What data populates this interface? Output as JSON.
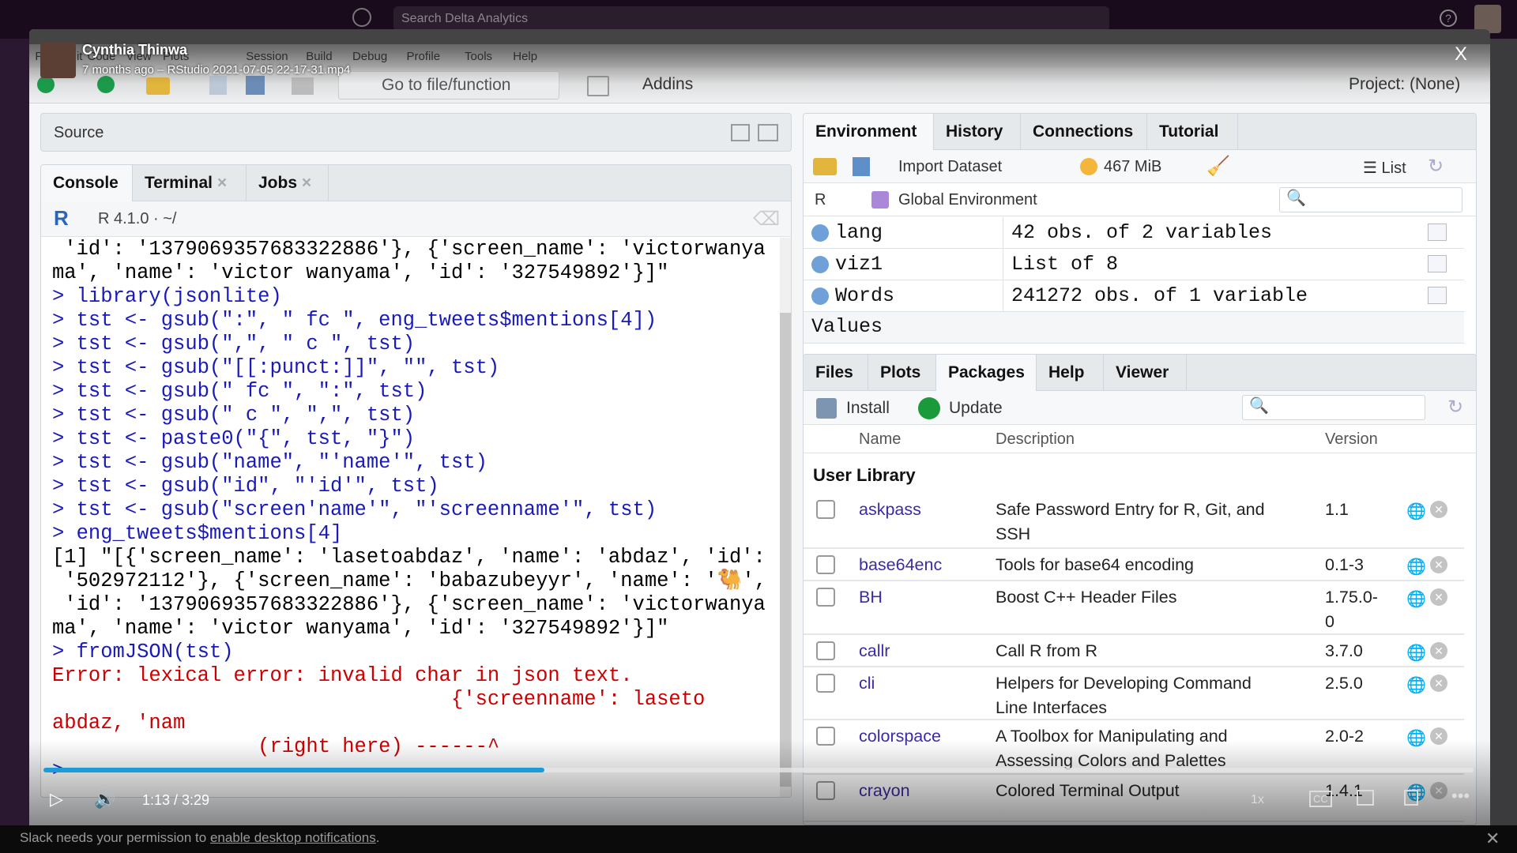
{
  "slack": {
    "search_placeholder": "Search Delta Analytics",
    "notification_text": "Slack needs your permission to ",
    "notification_link": "enable desktop notifications",
    "notification_end": "."
  },
  "video": {
    "author": "Cynthia Thinwa",
    "subtitle": "7 months ago – RStudio 2021-07-05 22-17-31.mp4",
    "time": "1:13 / 3:29",
    "progress": 0.35,
    "speed": "1x",
    "close": "X"
  },
  "menu": [
    "File",
    "Edit",
    "Code",
    "View",
    "Plots",
    "Session",
    "Build",
    "Debug",
    "Profile",
    "Tools",
    "Help"
  ],
  "toolbar": {
    "goto_placeholder": "Go to file/function",
    "addins": "Addins",
    "project": "Project: (None)"
  },
  "source": {
    "title": "Source"
  },
  "console": {
    "tabs": [
      "Console",
      "Terminal",
      "Jobs"
    ],
    "r_version": "R 4.1.0 · ~/",
    "lines": [
      {
        "t": " 'id': '1379069357683322886'}, {'screen_name': 'victorwanya",
        "c": ""
      },
      {
        "t": "ma', 'name': 'victor wanyama', 'id': '327549892'}]\"",
        "c": ""
      },
      {
        "t": "> library(jsonlite)",
        "c": "blue"
      },
      {
        "t": "> tst <- gsub(\":\", \" fc \", eng_tweets$mentions[4])",
        "c": "blue"
      },
      {
        "t": "> tst <- gsub(\",\", \" c \", tst)",
        "c": "blue"
      },
      {
        "t": "> tst <- gsub(\"[[:punct:]]\", \"\", tst)",
        "c": "blue"
      },
      {
        "t": "> tst <- gsub(\" fc \", \":\", tst)",
        "c": "blue"
      },
      {
        "t": "> tst <- gsub(\" c \", \",\", tst)",
        "c": "blue"
      },
      {
        "t": "> tst <- paste0(\"{\", tst, \"}\")",
        "c": "blue"
      },
      {
        "t": "> tst <- gsub(\"name\", \"'name'\", tst)",
        "c": "blue"
      },
      {
        "t": "> tst <- gsub(\"id\", \"'id'\", tst)",
        "c": "blue"
      },
      {
        "t": "> tst <- gsub(\"screen'name'\", \"'screenname'\", tst)",
        "c": "blue"
      },
      {
        "t": "> eng_tweets$mentions[4]",
        "c": "blue"
      },
      {
        "t": "[1] \"[{'screen_name': 'lasetoabdaz', 'name': 'abdaz', 'id':",
        "c": ""
      },
      {
        "t": " '502972112'}, {'screen_name': 'babazubeyyr', 'name': '🐫',",
        "c": ""
      },
      {
        "t": " 'id': '1379069357683322886'}, {'screen_name': 'victorwanya",
        "c": ""
      },
      {
        "t": "ma', 'name': 'victor wanyama', 'id': '327549892'}]\"",
        "c": ""
      },
      {
        "t": "> fromJSON(tst)",
        "c": "blue"
      },
      {
        "t": "Error: lexical error: invalid char in json text.",
        "c": "red"
      },
      {
        "t": "                                 {'screenname': laseto",
        "c": "red"
      },
      {
        "t": "abdaz, 'nam",
        "c": "red"
      },
      {
        "t": "                 (right here) ------^",
        "c": "red"
      },
      {
        "t": ">",
        "c": "blue"
      }
    ]
  },
  "environment": {
    "tabs": [
      "Environment",
      "History",
      "Connections",
      "Tutorial"
    ],
    "import_dataset": "Import Dataset",
    "memory": "467 MiB",
    "view_mode": "List",
    "language": "R",
    "scope": "Global Environment",
    "rows": [
      {
        "name": "lang",
        "value": "42 obs. of 2 variables",
        "icon": "table-icon"
      },
      {
        "name": "viz1",
        "value": "List of  8",
        "icon": "search-icon"
      },
      {
        "name": "Words",
        "value": "241272 obs. of 1 variable",
        "icon": "table-icon"
      }
    ],
    "section": "Values"
  },
  "packages": {
    "tabs": [
      "Files",
      "Plots",
      "Packages",
      "Help",
      "Viewer"
    ],
    "install": "Install",
    "update": "Update",
    "columns": [
      "Name",
      "Description",
      "Version"
    ],
    "library": "User Library",
    "rows": [
      {
        "name": "askpass",
        "desc": "Safe Password Entry for R, Git, and SSH",
        "version": "1.1"
      },
      {
        "name": "base64enc",
        "desc": "Tools for base64 encoding",
        "version": "0.1-3"
      },
      {
        "name": "BH",
        "desc": "Boost C++ Header Files",
        "version": "1.75.0-0"
      },
      {
        "name": "callr",
        "desc": "Call R from R",
        "version": "3.7.0"
      },
      {
        "name": "cli",
        "desc": "Helpers for Developing Command Line Interfaces",
        "version": "2.5.0"
      },
      {
        "name": "colorspace",
        "desc": "A Toolbox for Manipulating and Assessing Colors and Palettes",
        "version": "2.0-2"
      },
      {
        "name": "crayon",
        "desc": "Colored Terminal Output",
        "version": "1.4.1"
      }
    ]
  }
}
